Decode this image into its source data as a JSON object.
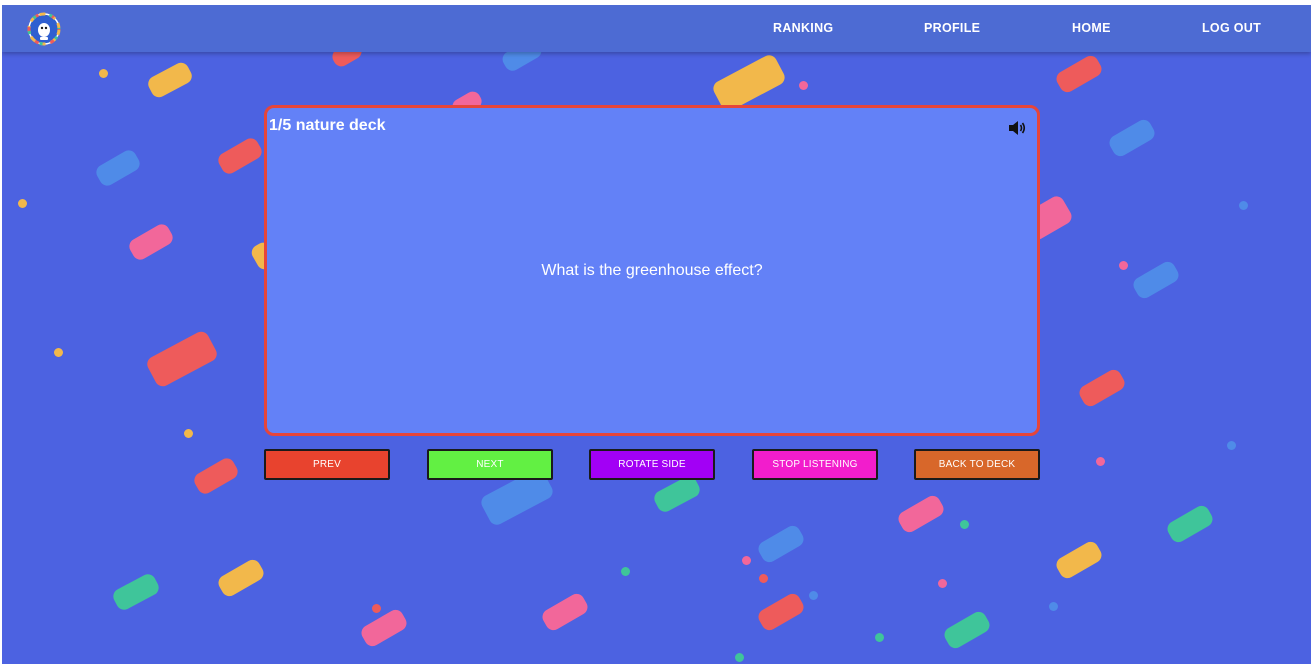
{
  "nav": {
    "logo_icon": "avatar-badge-icon",
    "links": [
      "RANKING",
      "PROFILE",
      "HOME",
      "LOG OUT"
    ]
  },
  "card": {
    "title": "1/5 nature deck",
    "speaker_icon": "speaker-icon",
    "question": "What is the greenhouse effect?"
  },
  "buttons": {
    "prev": "PREV",
    "next": "NEXT",
    "rotate": "ROTATE SIDE",
    "stop": "STOP LISTENING",
    "back": "BACK TO DECK"
  },
  "colors": {
    "background": "#4c62e1",
    "navbar": "#4d6bd3",
    "card": "#6381f7",
    "card_border": "#e6453a",
    "prev": "#e8432e",
    "next": "#62f043",
    "rotate": "#a200f5",
    "stop": "#f21dcc",
    "back": "#d8672a"
  }
}
